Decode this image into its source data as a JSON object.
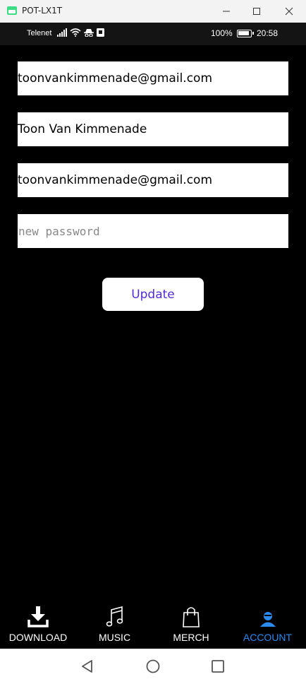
{
  "window": {
    "title": "POT-LX1T"
  },
  "statusbar": {
    "carrier": "Telenet",
    "battery_percent": "100%",
    "time": "20:58"
  },
  "form": {
    "email_value": "toonvankimmenade@gmail.com",
    "name_value": "Toon Van Kimmenade",
    "email_confirm_value": "toonvankimmenade@gmail.com",
    "password_placeholder": "new password",
    "update_label": "Update"
  },
  "tabs": [
    {
      "label": "DOWNLOAD",
      "icon": "download-icon",
      "active": false
    },
    {
      "label": "MUSIC",
      "icon": "music-note-icon",
      "active": false
    },
    {
      "label": "MERCH",
      "icon": "shopping-bag-icon",
      "active": false
    },
    {
      "label": "ACCOUNT",
      "icon": "user-icon",
      "active": true
    }
  ],
  "colors": {
    "background": "#000000",
    "accent": "#2a8aee",
    "button_text": "#512bd4"
  }
}
